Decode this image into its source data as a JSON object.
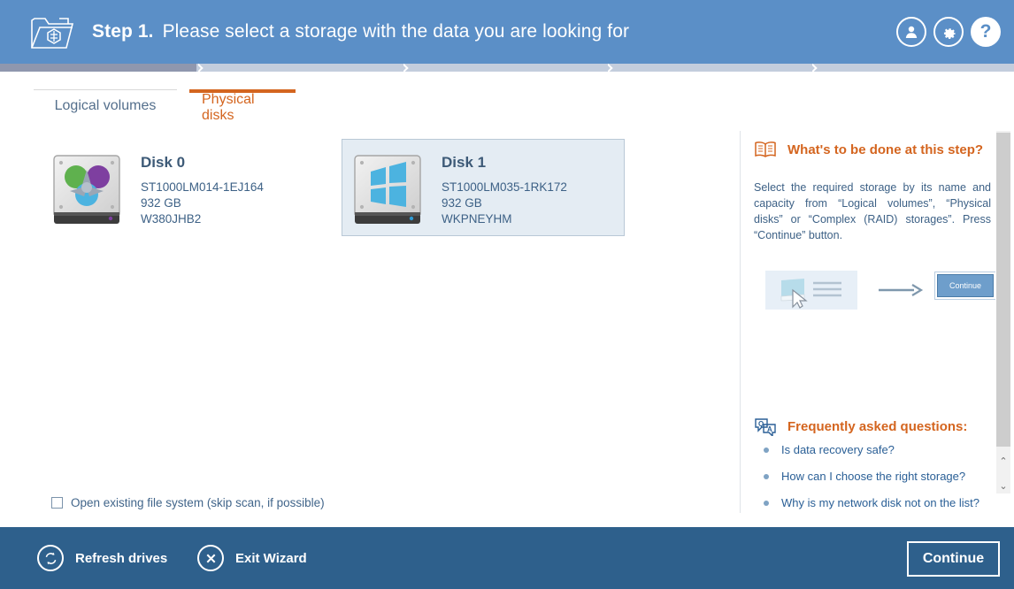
{
  "header": {
    "step_label": "Step 1.",
    "title": "Please select a storage with the data you are looking for",
    "logo_icon": "folder-atom-logo-icon",
    "icons": [
      {
        "name": "user-icon",
        "glyph": "♟"
      },
      {
        "name": "gear-icon",
        "glyph": "⚙"
      },
      {
        "name": "help-icon",
        "glyph": "?"
      }
    ],
    "bg_color": "#5b8fc7"
  },
  "progress": {
    "steps_total": 5,
    "current_step": 1,
    "fill_color": "#8f97ae",
    "track_color": "#c3cddd"
  },
  "tabs": [
    {
      "id": "logical",
      "label": "Logical volumes",
      "active": false
    },
    {
      "id": "physical",
      "label": "Physical disks",
      "active": true
    }
  ],
  "accent_color": "#d4651f",
  "disks": [
    {
      "title": "Disk 0",
      "model": "ST1000LM014-1EJ164",
      "capacity": "932 GB",
      "serial": "W380JHB2",
      "icon": "hard-disk-linux-icon",
      "selected": false
    },
    {
      "title": "Disk 1",
      "model": "ST1000LM035-1RK172",
      "capacity": "932 GB",
      "serial": "WKPNEYHM",
      "icon": "hard-disk-windows-icon",
      "selected": true
    }
  ],
  "checkbox": {
    "label": "Open existing file system (skip scan, if possible)",
    "checked": false
  },
  "side_panel": {
    "whats_done": {
      "icon": "open-book-icon",
      "heading": "What's to be done at this step?",
      "body": "Select the required storage by its name and capacity from “Logical volumes”, “Physical disks” or “Complex (RAID) storages”. Press “Continue” button."
    },
    "illustration": {
      "storage_icon": "storage-list-icon",
      "cursor_icon": "mouse-cursor-icon",
      "arrow_icon": "arrow-right-icon",
      "button_label": "Continue"
    },
    "faq": {
      "icon": "question-answer-bubble-icon",
      "heading": "Frequently asked questions:",
      "items": [
        "Is data recovery safe?",
        "How can I choose the right storage?",
        "Why is my network disk not on the list?"
      ]
    }
  },
  "scrollbar": {
    "up_arrow": "⌃",
    "down_arrow": "⌄"
  },
  "footer": {
    "bg_color": "#2e608c",
    "refresh": {
      "label": "Refresh drives",
      "icon": "refresh-icon"
    },
    "exit": {
      "label": "Exit Wizard",
      "icon": "close-x-icon"
    },
    "continue": {
      "label": "Continue"
    }
  }
}
